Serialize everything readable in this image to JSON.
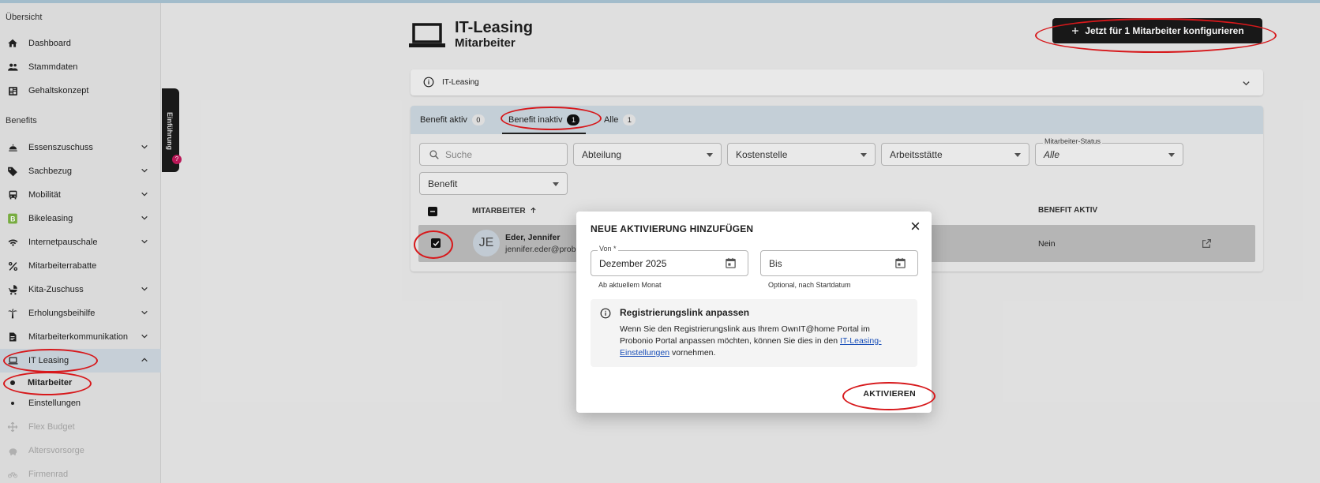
{
  "sidebar": {
    "section_overview": "Übersicht",
    "overview_items": [
      {
        "label": "Dashboard",
        "icon": "home-icon"
      },
      {
        "label": "Stammdaten",
        "icon": "people-icon"
      },
      {
        "label": "Gehaltskonzept",
        "icon": "grid-icon"
      }
    ],
    "section_benefits": "Benefits",
    "benefit_items": [
      {
        "label": "Essenszuschuss",
        "icon": "food-icon"
      },
      {
        "label": "Sachbezug",
        "icon": "tag-icon"
      },
      {
        "label": "Mobilität",
        "icon": "bus-icon"
      },
      {
        "label": "Bikeleasing",
        "icon": "bike-logo-icon"
      },
      {
        "label": "Internetpauschale",
        "icon": "wifi-icon"
      },
      {
        "label": "Mitarbeiterrabatte",
        "icon": "percent-icon"
      },
      {
        "label": "Kita-Zuschuss",
        "icon": "stroller-icon"
      },
      {
        "label": "Erholungsbeihilfe",
        "icon": "palm-icon"
      },
      {
        "label": "Mitarbeiterkommunikation",
        "icon": "document-icon"
      },
      {
        "label": "IT Leasing",
        "icon": "laptop-icon"
      }
    ],
    "it_leasing_sub": [
      "Mitarbeiter",
      "Einstellungen"
    ],
    "disabled_items": [
      {
        "label": "Flex Budget",
        "icon": "arrows-icon"
      },
      {
        "label": "Altersvorsorge",
        "icon": "piggy-icon"
      },
      {
        "label": "Firmenrad",
        "icon": "bicycle-icon"
      }
    ],
    "intro_tab": "Einführung",
    "intro_badge": "?"
  },
  "header": {
    "title": "IT-Leasing",
    "subtitle": "Mitarbeiter",
    "cta": "Jetzt für 1 Mitarbeiter konfigurieren"
  },
  "info_bar": {
    "label": "IT-Leasing"
  },
  "tabs": [
    {
      "label": "Benefit aktiv",
      "count": "0"
    },
    {
      "label": "Benefit inaktiv",
      "count": "1"
    },
    {
      "label": "Alle",
      "count": "1"
    }
  ],
  "filters": {
    "search_placeholder": "Suche",
    "department": "Abteilung",
    "cost_center": "Kostenstelle",
    "workplace": "Arbeitsstätte",
    "status_label": "Mitarbeiter-Status",
    "status_value": "Alle",
    "benefit": "Benefit"
  },
  "table": {
    "col_employee": "MITARBEITER",
    "col_benefit_active": "BENEFIT AKTIV",
    "row": {
      "initials": "JE",
      "name": "Eder, Jennifer",
      "email": "jennifer.eder@prob",
      "benefit_active": "Nein"
    }
  },
  "dialog": {
    "title": "NEUE AKTIVIERUNG HINZUFÜGEN",
    "from_label": "Von *",
    "from_value": "Dezember 2025",
    "from_help": "Ab aktuellem Monat",
    "to_placeholder": "Bis",
    "to_help": "Optional, nach Startdatum",
    "info_title": "Registrierungslink anpassen",
    "info_text_1": "Wenn Sie den Registrierungslink aus Ihrem OwnIT@home Portal im Probonio Portal anpassen möchten, können Sie dies in den ",
    "info_link": "IT-Leasing-Einstellungen",
    "info_text_2": " vornehmen.",
    "action": "AKTIVIEREN"
  },
  "colors": {
    "annotation_ring": "#d7181b",
    "primary_dark": "#1a1a1a",
    "link": "#1a4fb8"
  }
}
